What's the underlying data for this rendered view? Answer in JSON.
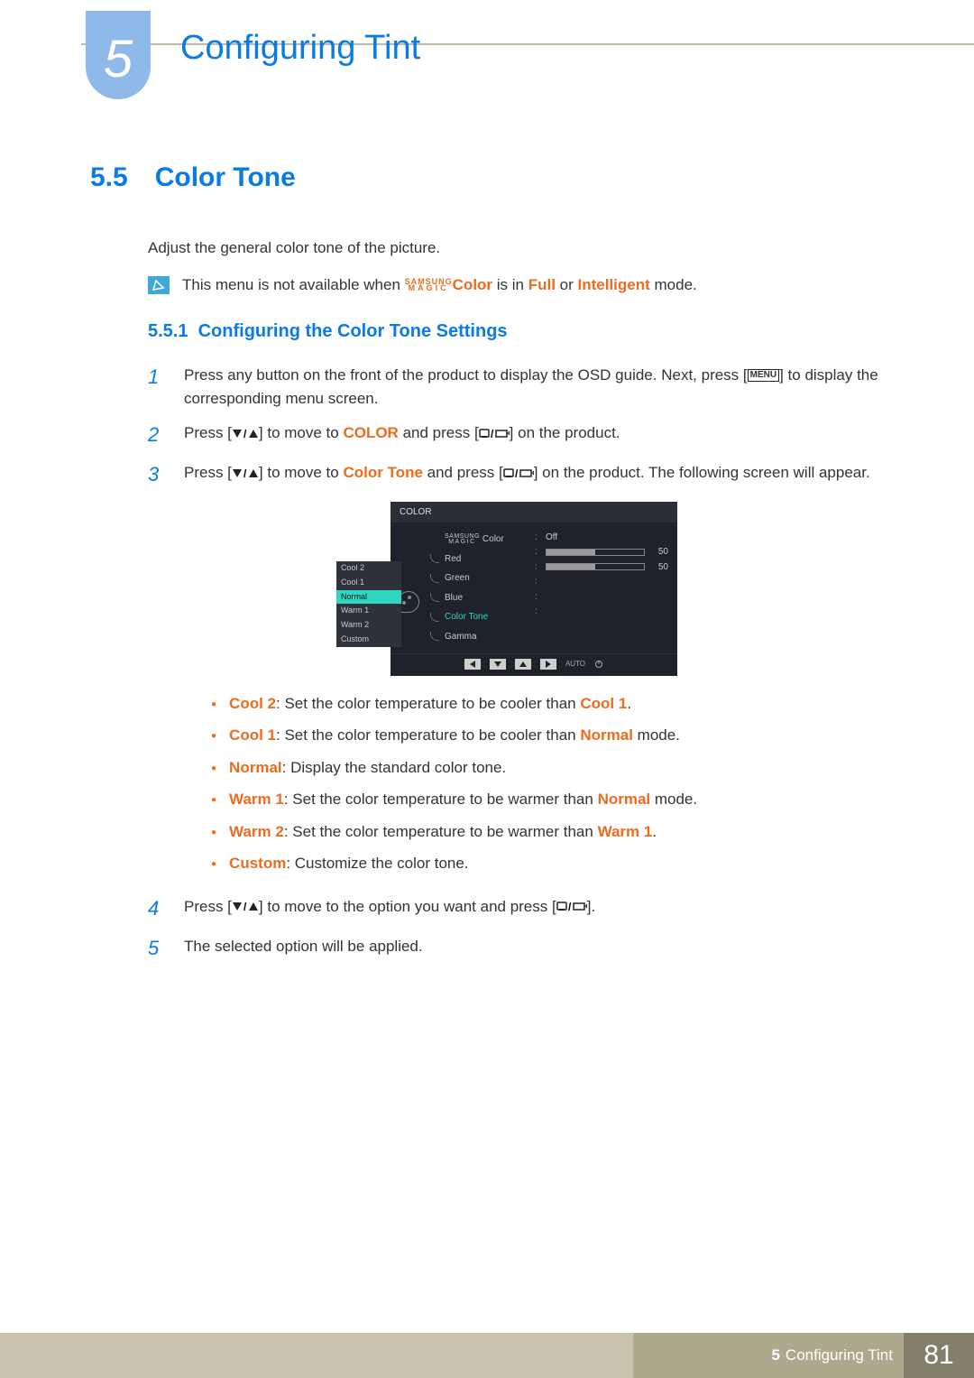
{
  "chapter": {
    "number": "5",
    "title": "Configuring Tint"
  },
  "section": {
    "number": "5.5",
    "title": "Color Tone"
  },
  "intro": "Adjust the general color tone of the picture.",
  "note": {
    "pre": "This menu is not available when ",
    "magic_top": "SAMSUNG",
    "magic_bot": "MAGIC",
    "color_word": "Color",
    "mid": " is in ",
    "full": "Full",
    "or": " or ",
    "intelligent": "Intelligent",
    "post": " mode."
  },
  "subsection": {
    "number": "5.5.1",
    "title": "Configuring the Color Tone Settings"
  },
  "steps": {
    "s1": {
      "pre": "Press any button on the front of the product to display the OSD guide. Next, press [",
      "menu": "MENU",
      "post": "] to display the corresponding menu screen."
    },
    "s2": {
      "pre": "Press [",
      "mid1": "] to move to ",
      "color": "COLOR",
      "mid2": " and press [",
      "post": "] on the product."
    },
    "s3": {
      "pre": "Press [",
      "mid1": "] to move to ",
      "ct": "Color Tone",
      "mid2": " and press [",
      "post": "] on the product. The following screen will appear."
    },
    "s4": {
      "pre": "Press [",
      "mid": "] to move to the option you want and press [",
      "post": "]."
    },
    "s5": "The selected option will be applied."
  },
  "osd": {
    "title": "COLOR",
    "rows": {
      "magic_top": "SAMSUNG",
      "magic_bot": "MAGIC",
      "magic_label": "Color",
      "magic_value": "Off",
      "red": "Red",
      "red_val": "50",
      "green": "Green",
      "green_val": "50",
      "blue": "Blue",
      "colortone": "Color Tone",
      "gamma": "Gamma"
    },
    "dropdown": [
      "Cool 2",
      "Cool 1",
      "Normal",
      "Warm 1",
      "Warm 2",
      "Custom"
    ],
    "nav_auto": "AUTO"
  },
  "bullets": {
    "b1": {
      "k": "Cool 2",
      "t": ": Set the color temperature to be cooler than ",
      "k2": "Cool 1",
      "t2": "."
    },
    "b2": {
      "k": "Cool 1",
      "t": ": Set the color temperature to be cooler than ",
      "k2": "Normal",
      "t2": " mode."
    },
    "b3": {
      "k": "Normal",
      "t": ": Display the standard color tone."
    },
    "b4": {
      "k": "Warm 1",
      "t": ": Set the color temperature to be warmer than ",
      "k2": "Normal",
      "t2": " mode."
    },
    "b5": {
      "k": "Warm 2",
      "t": ": Set the color temperature to be warmer than ",
      "k2": "Warm 1",
      "t2": "."
    },
    "b6": {
      "k": "Custom",
      "t": ": Customize the color tone."
    }
  },
  "footer": {
    "num": "5",
    "title": "Configuring Tint",
    "page": "81"
  }
}
